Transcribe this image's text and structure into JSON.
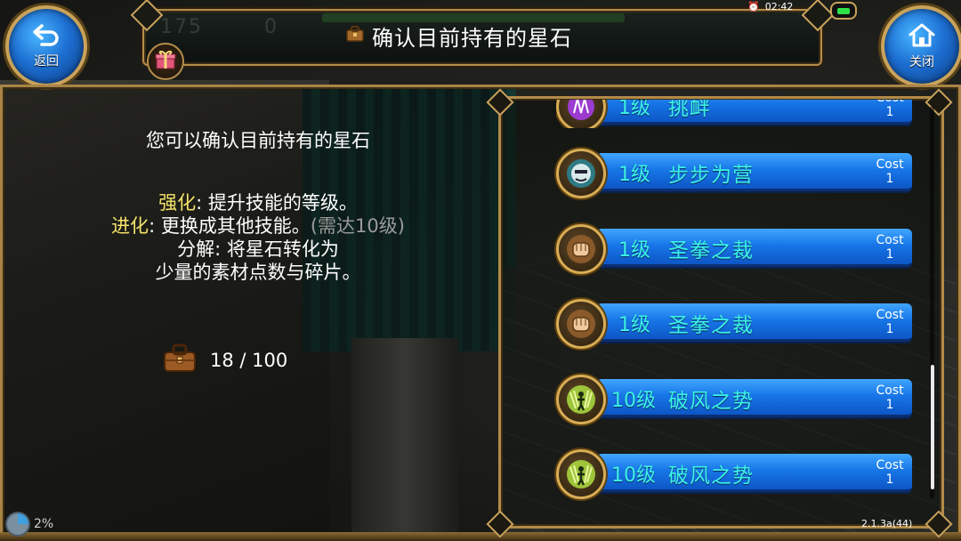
{
  "header": {
    "title": "确认目前持有的星石",
    "back_label": "返回",
    "close_label": "关闭",
    "ghost_stat_1": "175",
    "ghost_stat_2": "0",
    "time": "02:42"
  },
  "info": {
    "intro": "您可以确认目前持有的星石",
    "enhance_key": "强化",
    "enhance_text": ": 提升技能的等级。",
    "evolve_key": "进化",
    "evolve_text": ": 更换成其他技能。",
    "evolve_note": "(需达10级)",
    "dismantle_line1": "分解: 将星石转化为",
    "dismantle_line2": "少量的素材点数与碎片。",
    "bag_count": "18 / 100"
  },
  "stones": [
    {
      "level": "1级",
      "name": "挑衅",
      "cost_label": "Cost",
      "cost": "1",
      "icon": "purple-skill-icon"
    },
    {
      "level": "1级",
      "name": "步步为营",
      "cost_label": "Cost",
      "cost": "1",
      "icon": "armored-face-icon"
    },
    {
      "level": "1级",
      "name": "圣拳之裁",
      "cost_label": "Cost",
      "cost": "1",
      "icon": "fist-icon"
    },
    {
      "level": "1级",
      "name": "圣拳之裁",
      "cost_label": "Cost",
      "cost": "1",
      "icon": "fist-icon"
    },
    {
      "level": "10级",
      "name": "破风之势",
      "cost_label": "Cost",
      "cost": "1",
      "icon": "wind-figure-icon"
    },
    {
      "level": "10级",
      "name": "破风之势",
      "cost_label": "Cost",
      "cost": "1",
      "icon": "wind-figure-icon"
    }
  ],
  "footer": {
    "loading": "2%",
    "version": "2.1.3a(44)"
  },
  "colors": {
    "accent_gold": "#b58d4b",
    "button_blue": "#1877e8",
    "skill_text_cyan": "#3df3e6",
    "highlight_yellow": "#f5e36a"
  }
}
